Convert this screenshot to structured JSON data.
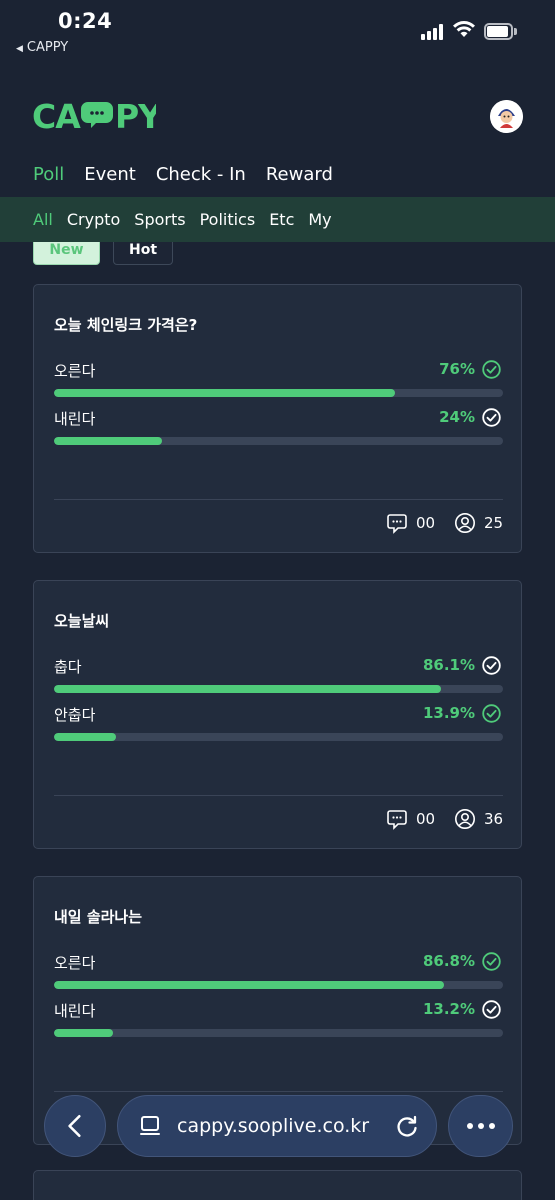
{
  "status": {
    "time": "0:24",
    "back_app": "CAPPY"
  },
  "brand": {
    "logo_text": "CAPPY",
    "accent": "#4fcb7a"
  },
  "main_tabs": [
    {
      "label": "Poll",
      "active": true
    },
    {
      "label": "Event",
      "active": false
    },
    {
      "label": "Check - In",
      "active": false
    },
    {
      "label": "Reward",
      "active": false
    }
  ],
  "categories": [
    {
      "label": "All",
      "active": true
    },
    {
      "label": "Crypto",
      "active": false
    },
    {
      "label": "Sports",
      "active": false
    },
    {
      "label": "Politics",
      "active": false
    },
    {
      "label": "Etc",
      "active": false
    },
    {
      "label": "My",
      "active": false
    }
  ],
  "sort": {
    "new": "New",
    "hot": "Hot",
    "selected": "New"
  },
  "polls": [
    {
      "question": "오늘 체인링크 가격은?",
      "options": [
        {
          "label": "오른다",
          "percent_text": "76%",
          "percent": 76,
          "selected": true
        },
        {
          "label": "내린다",
          "percent_text": "24%",
          "percent": 24,
          "selected": false
        }
      ],
      "comments": "00",
      "participants": "25"
    },
    {
      "question": "오늘날씨",
      "options": [
        {
          "label": "춥다",
          "percent_text": "86.1%",
          "percent": 86.1,
          "selected": false
        },
        {
          "label": "안춥다",
          "percent_text": "13.9%",
          "percent": 13.9,
          "selected": true
        }
      ],
      "comments": "00",
      "participants": "36"
    },
    {
      "question": "내일 솔라나는",
      "options": [
        {
          "label": "오른다",
          "percent_text": "86.8%",
          "percent": 86.8,
          "selected": true
        },
        {
          "label": "내린다",
          "percent_text": "13.2%",
          "percent": 13.2,
          "selected": false
        }
      ],
      "comments": "",
      "participants": ""
    }
  ],
  "browser": {
    "url": "cappy.sooplive.co.kr"
  }
}
